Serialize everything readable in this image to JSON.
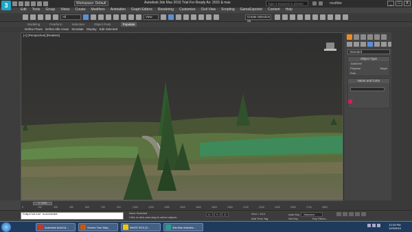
{
  "app": {
    "logo_letter": "3",
    "workspace": "Workspace: Default",
    "title": "Autodesk 3ds Max 2016   Trial For Ready   Ax: 2015 & max",
    "search_placeholder": "Type a keyword or phrase",
    "user": "ncuthbe",
    "win_minimize": "_",
    "win_maximize": "□",
    "win_close": "X"
  },
  "menu": [
    "Edit",
    "Tools",
    "Group",
    "Views",
    "Create",
    "Modifiers",
    "Animation",
    "Graph Editors",
    "Rendering",
    "Customize",
    "Civil View",
    "Scripting",
    "GameExporter",
    "Content",
    "Help"
  ],
  "toolbar": {
    "selection_filter": "All",
    "ref_coord": "View",
    "named_selection": "Create Selection Se"
  },
  "ribbon": {
    "tabs": [
      "Modeling",
      "Freeform",
      "Selection",
      "Object Paint",
      "Populate"
    ],
    "active": "Populate"
  },
  "scene_menu": [
    "Define Flows",
    "Define Idle Areas",
    "Simulate",
    "Display",
    "Edit Selected"
  ],
  "viewport": {
    "label": "[+] [Perspective] [Realistic]"
  },
  "command_panel": {
    "dropdown": "Standard",
    "object_type_title": "Object Type",
    "autogrid": "AutoGrid",
    "buttons": [
      "Physical",
      "Target",
      "Free"
    ],
    "name_color_title": "Name and Color",
    "color": "#d81a5a"
  },
  "timeline": {
    "slider": "0 / 3000",
    "ticks": [
      "0",
      "150",
      "300",
      "450",
      "600",
      "750",
      "900",
      "1050",
      "1200",
      "1350",
      "1500",
      "1650",
      "1800",
      "1950",
      "2100",
      "2250",
      "2400",
      "2550",
      "2700",
      "2850"
    ]
  },
  "status": {
    "maxscript": "Compilation succeeded.",
    "selected": "None Selected",
    "prompt": "Click or click-and-drag to select objects",
    "x_label": "X:",
    "y_label": "Y:",
    "z_label": "Z:",
    "grid": "Grid = 10.0",
    "add_time_tag": "Add Time Tag",
    "auto_key": "Auto Key",
    "selected_dd": "Selected",
    "set_key": "Set Key",
    "key_filters": "Key Filters..."
  },
  "taskbar": {
    "tasks": [
      {
        "label": "Autodesk AutoCA...",
        "color": "#c0392b"
      },
      {
        "label": "Screen Tour May...",
        "color": "#d35400"
      },
      {
        "label": "WeOS SCS (3...",
        "color": "#f1c40f"
      },
      {
        "label": "3ds Max Autodes...",
        "color": "#2a9d8f"
      }
    ],
    "clock_time": "12:33 PM",
    "clock_date": "12/3/2015"
  }
}
